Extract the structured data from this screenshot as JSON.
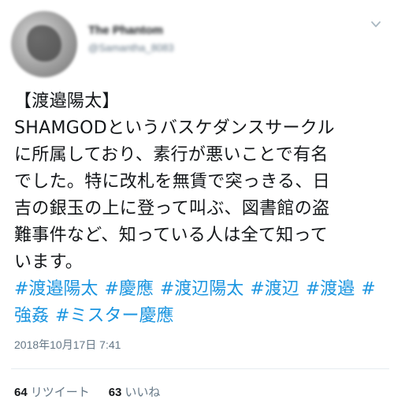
{
  "author": {
    "display_name": "The Phantom",
    "handle": "@Samantha_8083"
  },
  "tweet": {
    "title": "【渡邉陽太】",
    "lines": [
      "SHAMGODというバスケダンスサークル",
      "に所属しており、素行が悪いことで有名",
      "でした。特に改札を無賃で突っきる、日",
      "吉の銀玉の上に登って叫ぶ、図書館の盗",
      "難事件など、知っている人は全て知って",
      "います。"
    ],
    "hashtags": [
      "#渡邉陽太",
      "#慶應",
      "#渡辺陽太",
      "#渡辺",
      "#渡邉",
      "#強姦",
      "#ミスター慶應"
    ],
    "timestamp": "2018年10月17日 7:41"
  },
  "stats": {
    "retweets_count": "64",
    "retweets_label": "リツイート",
    "likes_count": "63",
    "likes_label": "いいね"
  },
  "colors": {
    "text": "#14171a",
    "link": "#1b95e0",
    "muted": "#657786",
    "divider": "#e6ecf0"
  },
  "icons": {
    "caret": "chevron-down-icon"
  }
}
